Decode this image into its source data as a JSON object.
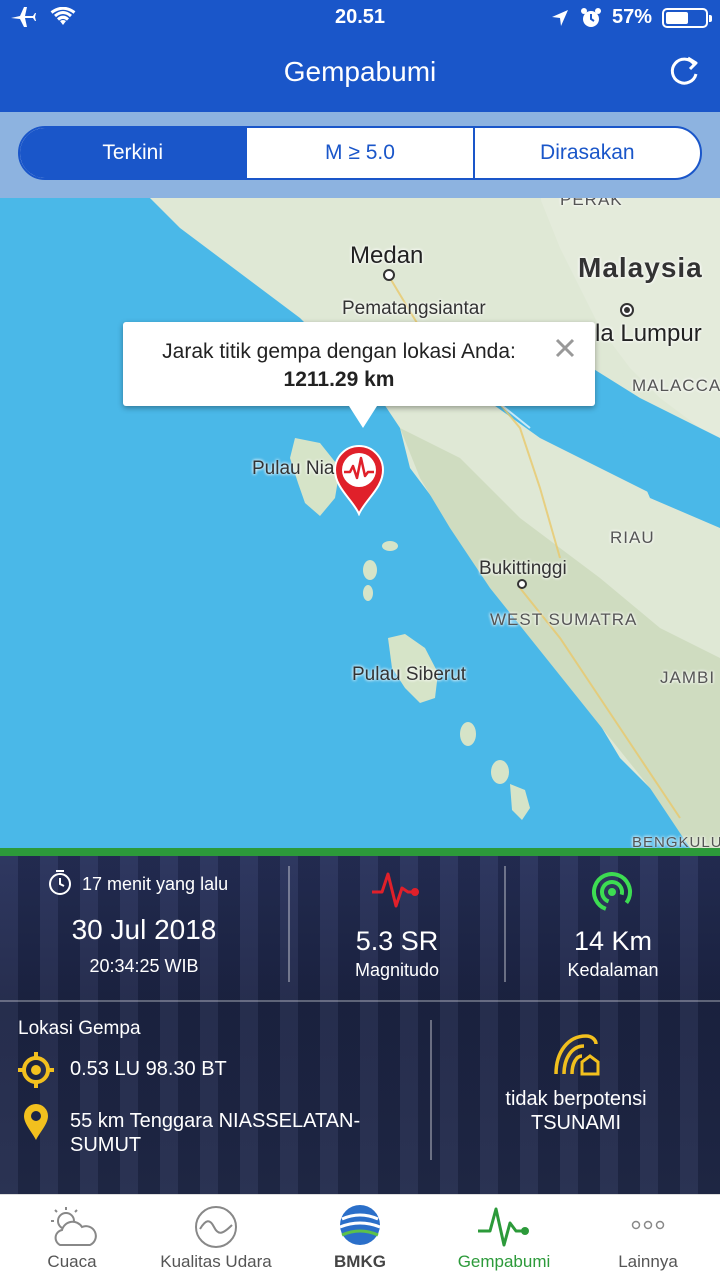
{
  "status_bar": {
    "time": "20.51",
    "battery": "57%",
    "battery_level": 0.57
  },
  "header": {
    "title": "Gempabumi"
  },
  "segments": [
    {
      "label": "Terkini",
      "active": true
    },
    {
      "label": "M ≥ 5.0",
      "active": false
    },
    {
      "label": "Dirasakan",
      "active": false
    }
  ],
  "map": {
    "labels": {
      "medan": "Medan",
      "malaysia": "Malaysia",
      "pematangsiantar": "Pematangsiantar",
      "kuala_lumpur": "la Lumpur",
      "malacca": "MALACCA",
      "perak": "PERAK",
      "pulau_nias": "Pulau Nia",
      "riau": "RIAU",
      "bukittinggi": "Bukittinggi",
      "west_sumatra": "WEST SUMATRA",
      "pulau_siberut": "Pulau Siberut",
      "jambi": "JAMBI",
      "bengkulu": "BENGKULU"
    },
    "popup": {
      "line1": "Jarak titik gempa dengan lokasi Anda:",
      "line2": "1211.29 km"
    }
  },
  "info": {
    "time_ago": "17 menit yang lalu",
    "date": "30 Jul 2018",
    "time": "20:34:25 WIB",
    "magnitude_value": "5.3 SR",
    "magnitude_label": "Magnitudo",
    "depth_value": "14 Km",
    "depth_label": "Kedalaman",
    "location_title": "Lokasi Gempa",
    "coordinates": "0.53 LU 98.30 BT",
    "place_line1": "55 km Tenggara NIASSELATAN-",
    "place_line2": "SUMUT",
    "tsunami_line1": "tidak berpotensi",
    "tsunami_line2": "TSUNAMI"
  },
  "tabs": [
    {
      "label": "Cuaca",
      "icon": "cloud-sun-icon"
    },
    {
      "label": "Kualitas Udara",
      "icon": "air-quality-icon"
    },
    {
      "label": "BMKG",
      "icon": "bmkg-logo"
    },
    {
      "label": "Gempabumi",
      "icon": "seismograph-icon",
      "active": true
    },
    {
      "label": "Lainnya",
      "icon": "more-dots-icon"
    }
  ],
  "colors": {
    "primary": "#1a56c9",
    "active_tab": "#2c9a3a",
    "quake_pin": "#e0202a",
    "accent_yellow": "#f2c01e",
    "accent_green": "#3ddc52"
  }
}
